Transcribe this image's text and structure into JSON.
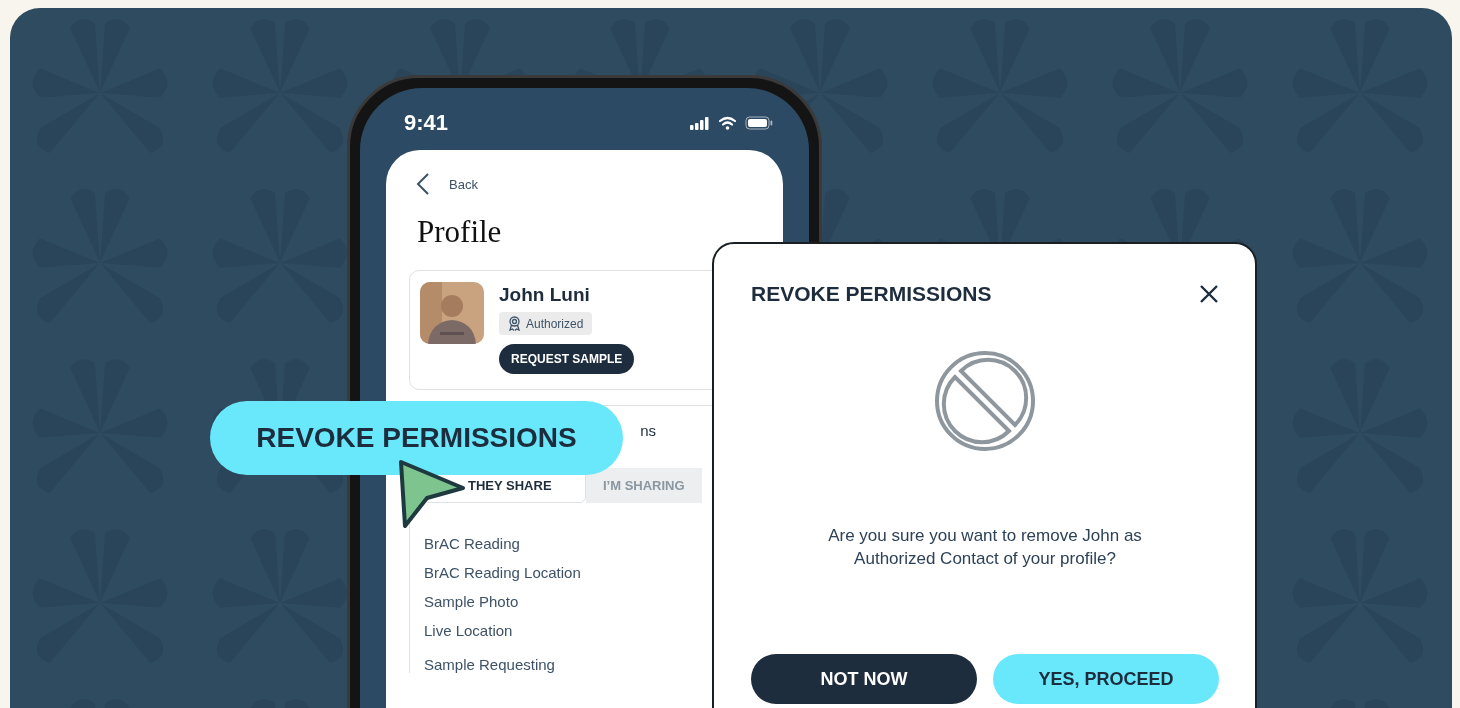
{
  "status_bar": {
    "time": "9:41"
  },
  "screen": {
    "back": "Back",
    "title": "Profile",
    "contact": {
      "name": "John Luni",
      "badge": "Authorized",
      "action": "REQUEST SAMPLE"
    },
    "section": {
      "heading": "ns",
      "tabs": [
        {
          "label": "THEY SHARE",
          "selected": true
        },
        {
          "label": "I’M SHARING",
          "selected": false
        }
      ],
      "items": [
        "BrAC Reading",
        "BrAC Reading Location",
        "Sample Photo",
        "Live Location",
        "Sample Requesting"
      ]
    }
  },
  "callout": {
    "label": "REVOKE PERMISSIONS"
  },
  "dialog": {
    "title": "REVOKE PERMISSIONS",
    "message": "Are you sure you want to remove John as Authorized Contact of your profile?",
    "buttons": [
      {
        "label": "NOT NOW",
        "kind": "secondary"
      },
      {
        "label": "YES, PROCEED",
        "kind": "primary"
      }
    ]
  }
}
